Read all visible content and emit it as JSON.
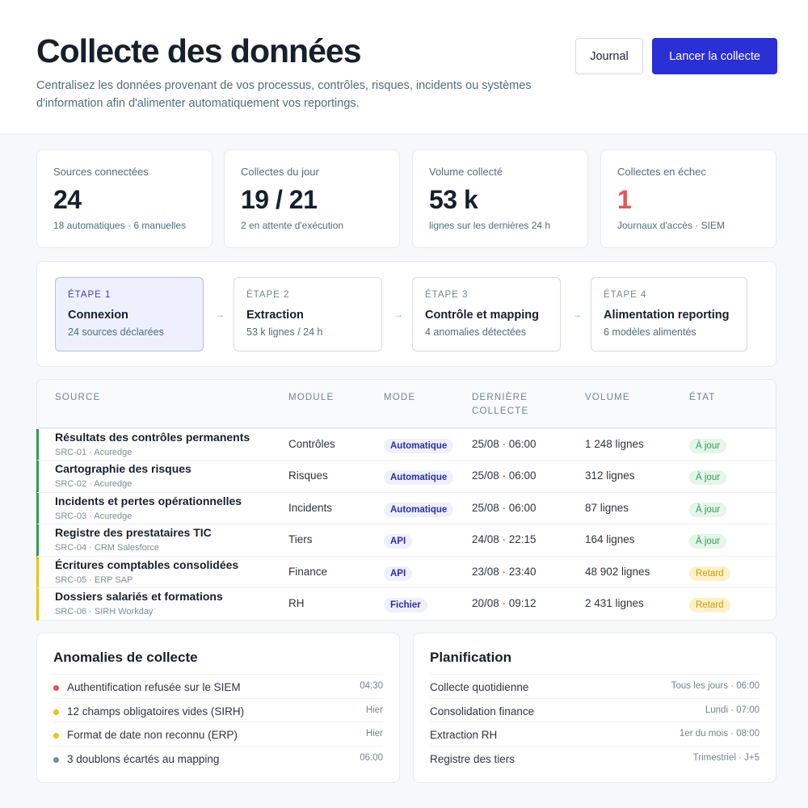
{
  "header": {
    "title": "Collecte des données",
    "subtitle": "Centralisez les données provenant de vos processus, contrôles, risques, incidents ou systèmes d'information afin d'alimenter automatiquement vos reportings.",
    "journal_label": "Journal",
    "launch_label": "Lancer la collecte"
  },
  "colors": {
    "accent": "#2a2fd6",
    "danger": "#e25555",
    "ok": "#2f9a52",
    "late": "#e8c21f",
    "neutral": "#6f8f98"
  },
  "stats": [
    {
      "label": "Sources connectées",
      "value": "24",
      "note": "18 automatiques · 6 manuelles"
    },
    {
      "label": "Collectes du jour",
      "value": "19 / 21",
      "note": "2 en attente d'exécution"
    },
    {
      "label": "Volume collecté",
      "value": "53 k",
      "note": "lignes sur les dernières 24 h"
    },
    {
      "label": "Collectes en échec",
      "value": "1",
      "note": "Journaux d'accès · SIEM"
    }
  ],
  "steps": [
    {
      "num": "ÉTAPE 1",
      "title": "Connexion",
      "desc": "24 sources déclarées"
    },
    {
      "num": "ÉTAPE 2",
      "title": "Extraction",
      "desc": "53 k lignes / 24 h"
    },
    {
      "num": "ÉTAPE 3",
      "title": "Contrôle et mapping",
      "desc": "4 anomalies détectées"
    },
    {
      "num": "ÉTAPE 4",
      "title": "Alimentation reporting",
      "desc": "6 modèles alimentés"
    }
  ],
  "table": {
    "headers": {
      "source": "SOURCE",
      "module": "MODULE",
      "mode": "MODE",
      "last_1": "DERNIÈRE",
      "last_2": "COLLECTE",
      "volume": "VOLUME",
      "state": "ÉTAT"
    },
    "rows": [
      {
        "name": "Résultats des contrôles permanents",
        "sub": "SRC-01 · Acuredge",
        "module": "Contrôles",
        "mode": "Automatique",
        "last": "25/08 · 06:00",
        "volume": "1 248 lignes",
        "state": "À jour"
      },
      {
        "name": "Cartographie des risques",
        "sub": "SRC-02 · Acuredge",
        "module": "Risques",
        "mode": "Automatique",
        "last": "25/08 · 06:00",
        "volume": "312 lignes",
        "state": "À jour"
      },
      {
        "name": "Incidents et pertes opérationnelles",
        "sub": "SRC-03 · Acuredge",
        "module": "Incidents",
        "mode": "Automatique",
        "last": "25/08 · 06:00",
        "volume": "87 lignes",
        "state": "À jour"
      },
      {
        "name": "Registre des prestataires TIC",
        "sub": "SRC-04 · CRM Salesforce",
        "module": "Tiers",
        "mode": "API",
        "last": "24/08 · 22:15",
        "volume": "164 lignes",
        "state": "À jour"
      },
      {
        "name": "Écritures comptables consolidées",
        "sub": "SRC-05 · ERP SAP",
        "module": "Finance",
        "mode": "API",
        "last": "23/08 · 23:40",
        "volume": "48 902 lignes",
        "state": "Retard"
      },
      {
        "name": "Dossiers salariés et formations",
        "sub": "SRC-06 · SIRH Workday",
        "module": "RH",
        "mode": "Fichier",
        "last": "20/08 · 09:12",
        "volume": "2 431 lignes",
        "state": "Retard"
      }
    ]
  },
  "anomalies": {
    "title": "Anomalies de collecte",
    "items": [
      {
        "text": "Authentification refusée sur le SIEM",
        "time": "04:30",
        "color": "#e25555"
      },
      {
        "text": "12 champs obligatoires vides (SIRH)",
        "time": "Hier",
        "color": "#e8c21f"
      },
      {
        "text": "Format de date non reconnu (ERP)",
        "time": "Hier",
        "color": "#e8c21f"
      },
      {
        "text": "3 doublons écartés au mapping",
        "time": "06:00",
        "color": "#6f8f98"
      }
    ]
  },
  "planning": {
    "title": "Planification",
    "items": [
      {
        "text": "Collecte quotidienne",
        "time": "Tous les jours · 06:00"
      },
      {
        "text": "Consolidation finance",
        "time": "Lundi · 07:00"
      },
      {
        "text": "Extraction RH",
        "time": "1er du mois · 08:00"
      },
      {
        "text": "Registre des tiers",
        "time": "Trimestriel · J+5"
      }
    ]
  }
}
